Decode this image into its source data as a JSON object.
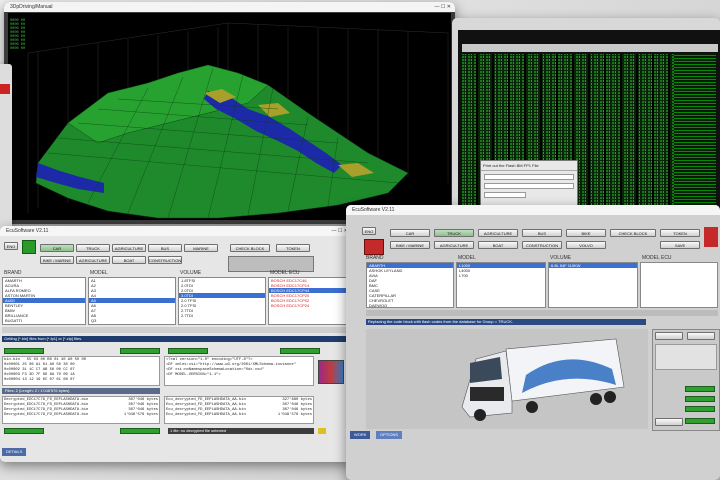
{
  "map_window": {
    "title": "3DpDriving/Manual",
    "surface_colors": {
      "low": "#1b8a2e",
      "high": "#23a42a",
      "peak_blue": "#1c2aa8",
      "peak_yellow": "#a8a02a"
    }
  },
  "hex_window": {
    "dialog_title": "Print out the Flash BM FP1 File"
  },
  "ecu_window": {
    "title": "EcuSoftware V2.11",
    "brand_selector": "ENG",
    "buttons_row1": [
      "CAR",
      "TRUCK",
      "AGRICULTURE",
      "BUS",
      "MARINE",
      "CHECK BLOCK",
      "TOKEN"
    ],
    "buttons_row2": [
      "BIKE / MARINE",
      "AGRICULTURE",
      "BOAT",
      "CONSTRUCTION"
    ],
    "columns": {
      "brand": "BRAND",
      "model": "MODEL",
      "volume": "VOLUME",
      "model_ecu": "MODEL ECU"
    },
    "brands": [
      "AMARTH",
      "ACURA",
      "ALFA ROMEO",
      "ASTON MARTIN",
      "AUDI",
      "BENTLEY",
      "BMW",
      "BRILLIANCE",
      "BUGATTI"
    ],
    "brand_selected": "AUDI",
    "models": [
      "A1",
      "A2",
      "A3",
      "A4",
      "A5",
      "A6",
      "A7",
      "A8",
      "Q3"
    ],
    "models_selected": "A5",
    "volumes": [
      "1.8TFSI",
      "2.0TDI",
      "2.0TDI",
      "3.0TDI",
      "2.0 TFSI",
      "2.0 TFSI",
      "2.7TDI",
      "2.7TDI"
    ],
    "volume_selected": "3.0TDI",
    "ecus": [
      "BOSCH EDC17C46",
      "BOSCH EDC17CP14",
      "BOSCH EDC17CP44",
      "BOSCH EDC17CP20",
      "BOSCH EDC17CP02",
      "BOSCH EDC17CP24"
    ],
    "ecu_selected": "BOSCH EDC17CP44",
    "info_line": "Getting [*.bin] files from [*.fp1] or [*.zip] files.",
    "console_left": [
      "bin.bin   55 03 00 B0 01 40 A0 50 00",
      "0x00001 25 06 A1 01 A0 50 30 00",
      "0x00002 31 1C C7 AB 56 00 CC 07",
      "0x00003 F3 3D 7F 0D 8A 7D 00 1A",
      "0x00004 13 12 19 0C 07 61 08 07"
    ],
    "console_right": [
      "<?xml version=\"1.0\" encoding=\"UTF-8\"?>",
      "<DF xmlns:xsi=\"http://www.w3.org/2001/XMLSchema-instance\"",
      "<DF xsi:noNamespaceSchemaLocation=\"Odx.xsd\"",
      "<DF MODEL-VERSION=\"1.1\">"
    ],
    "files": [
      [
        "Decrypted_EDC17C79_FD_EEPLASHDATA.bin",
        "307'046 bytes"
      ],
      [
        "Decrypted_EDC17C79_FD_EEPLASHDATA.bin",
        "307'046 bytes"
      ],
      [
        "Decrypted_EDC17C79_FD_EEPLASHDATA.bin",
        "307'046 bytes"
      ],
      [
        "Decrypted_EDC17C79_FD_EEPLASHDATA.bin",
        "1'048'576 bytes"
      ]
    ],
    "files_right": [
      [
        "Ecu_decrypted_FD_EEPLASHDATA_AA.bin",
        "327'680 bytes"
      ],
      [
        "Ecu_decrypted_FD_EEPLASHDATA_AA.bin",
        "307'046 bytes"
      ],
      [
        "Ecu_decrypted_FD_EEPLASHDATA_AA.bin",
        "307'046 bytes"
      ],
      [
        "Ecu_decrypted_FD_EEPLASHDATA_AA.bin",
        "1'048'576 bytes"
      ]
    ],
    "status_left": "Files: 2 (Length: 2 / 1'048'576 bytes)",
    "status_right": "1 file: no decrypted file selected",
    "bottom_tab": "DETAILS"
  },
  "truck_window": {
    "title": "EcuSoftware V2.11",
    "brand_selector": "ENG",
    "buttons_row1": [
      "CAR",
      "TRUCK",
      "AGRICULTURE",
      "BUS",
      "BIKE",
      "CHECK BLOCK",
      "TOKEN"
    ],
    "buttons_row2": [
      "BIKE / MARINE",
      "AGRICULTURE",
      "BOAT",
      "CONSTRUCTION",
      "VOLVO",
      "SAVE"
    ],
    "columns": {
      "brand": "BRAND",
      "model": "MODEL",
      "volume": "VOLUME",
      "model_ecu": "MODEL ECU"
    },
    "brands": [
      "ABARTH",
      "ASHOK LEYLAND",
      "AVIA",
      "DAF",
      "BMC",
      "CASE",
      "CATERPILLAR",
      "CHEVROLET",
      "DAEWOO"
    ],
    "brand_selected": "ABARTH",
    "models": [
      "L1000",
      "L4000",
      "L700"
    ],
    "models_selected": "L1000",
    "volumes": [
      "6.8L 54F 110KW"
    ],
    "volume_selected": "6.8L 54F 110KW",
    "info_line": "Replacing the code block with flash codes from the database for Group = TRUCK.",
    "bottom_tabs": [
      "WORK",
      "OPTIONS"
    ],
    "truck_colors": {
      "cab": "#e8eaee",
      "trailer": "#f3f4f7",
      "livery": "#2a6bbf"
    }
  }
}
